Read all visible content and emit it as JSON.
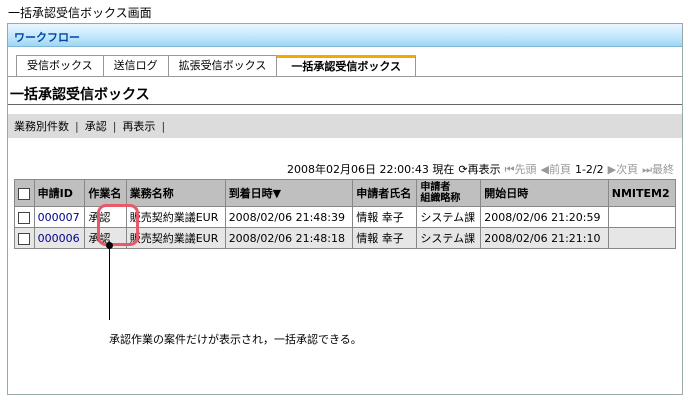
{
  "caption": "一括承認受信ボックス画面",
  "window": {
    "title": "ワークフロー"
  },
  "tabs": [
    {
      "label": "受信ボックス"
    },
    {
      "label": "送信ログ"
    },
    {
      "label": "拡張受信ボックス"
    },
    {
      "label": "一括承認受信ボックス",
      "active": true
    }
  ],
  "page_title": "一括承認受信ボックス",
  "toolbar": {
    "items": [
      "業務別件数",
      "承認",
      "再表示"
    ],
    "separator": "|"
  },
  "status": {
    "timestamp": "2008年02月06日 22:00:43 現在",
    "refresh": "再表示",
    "first": "先頭",
    "prev": "前頁",
    "range": "1-2/2",
    "next": "次頁",
    "last": "最終"
  },
  "table": {
    "headers": [
      "申請ID",
      "作業名",
      "業務名称",
      "到着日時▼",
      "申請者氏名",
      "申請者組織略称",
      "開始日時",
      "NMITEM2"
    ],
    "header_two_line": {
      "line1": "申請者",
      "line2": "組織略称"
    },
    "rows": [
      {
        "id": "000007",
        "task": "承認",
        "business": "販売契約業議EUR",
        "arrival": "2008/02/06 21:48:39",
        "applicant": "情報 幸子",
        "org": "システム課",
        "start": "2008/02/06 21:20:59",
        "nmitem2": ""
      },
      {
        "id": "000006",
        "task": "承認",
        "business": "販売契約業議EUR",
        "arrival": "2008/02/06 21:48:18",
        "applicant": "情報 幸子",
        "org": "システム課",
        "start": "2008/02/06 21:21:10",
        "nmitem2": ""
      }
    ]
  },
  "annotation": "承認作業の案件だけが表示され，一括承認できる。",
  "colors": {
    "highlight": "#e85a6a",
    "link": "#00008b",
    "tab_accent": "#f2a900"
  }
}
